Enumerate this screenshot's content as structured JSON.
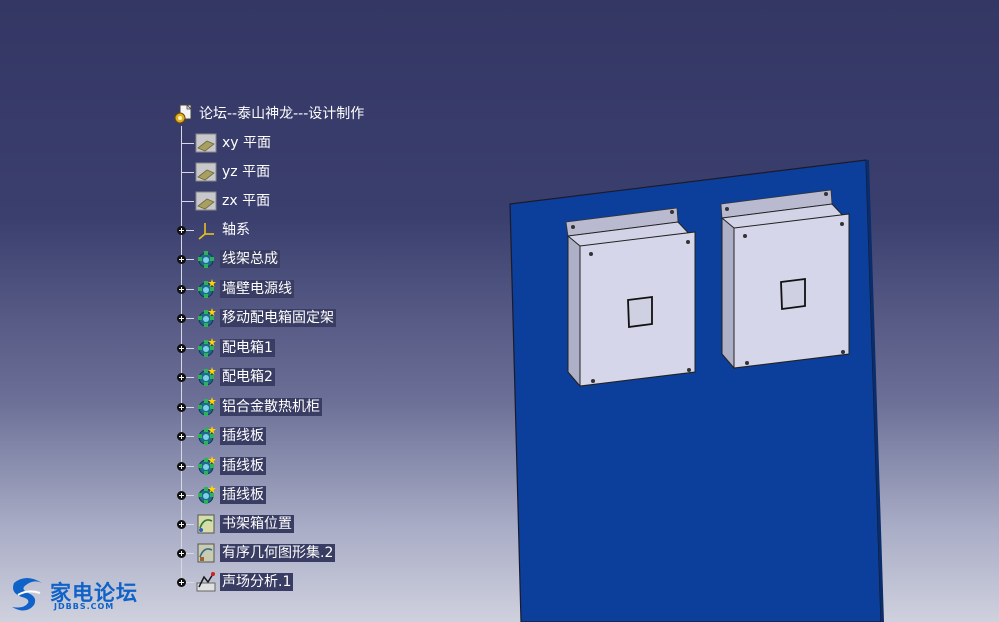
{
  "tree": {
    "root": {
      "label": "论坛--泰山神龙---设计制作",
      "icon": "part-document-icon"
    },
    "items": [
      {
        "label": "xy 平面",
        "icon": "plane-icon",
        "expandable": false
      },
      {
        "label": "yz 平面",
        "icon": "plane-icon",
        "expandable": false
      },
      {
        "label": "zx 平面",
        "icon": "plane-icon",
        "expandable": false
      },
      {
        "label": "轴系",
        "icon": "axis-system-icon",
        "expandable": true
      },
      {
        "label": "线架总成",
        "icon": "body-gear-icon",
        "expandable": true
      },
      {
        "label": "墙壁电源线",
        "icon": "body-gear-icon",
        "expandable": true
      },
      {
        "label": "移动配电箱固定架",
        "icon": "body-gear-icon",
        "expandable": true
      },
      {
        "label": "配电箱1",
        "icon": "body-gear-icon",
        "expandable": true
      },
      {
        "label": "配电箱2",
        "icon": "body-gear-icon",
        "expandable": true
      },
      {
        "label": "铝合金散热机柜",
        "icon": "body-gear-icon",
        "expandable": true
      },
      {
        "label": "插线板",
        "icon": "body-gear-icon",
        "expandable": true
      },
      {
        "label": "插线板",
        "icon": "body-gear-icon",
        "expandable": true
      },
      {
        "label": "插线板",
        "icon": "body-gear-icon",
        "expandable": true
      },
      {
        "label": "书架箱位置",
        "icon": "geometrical-set-icon",
        "expandable": true
      },
      {
        "label": "有序几何图形集.2",
        "icon": "ordered-geometrical-set-icon",
        "expandable": true
      },
      {
        "label": "声场分析.1",
        "icon": "analysis-icon",
        "expandable": true
      }
    ]
  },
  "watermark": {
    "text": "家电论坛",
    "sub": "JDBBS.COM"
  },
  "colors": {
    "panel": "#0b3f9b",
    "box": "#c9cbe0",
    "tree_line": "#d8d8e4"
  }
}
